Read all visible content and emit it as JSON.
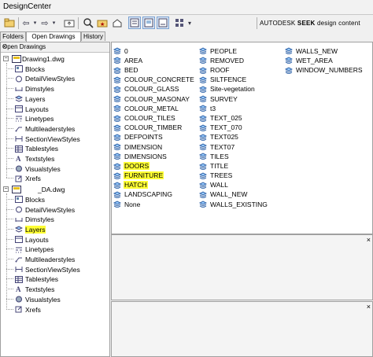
{
  "window": {
    "title": "DesignCenter"
  },
  "toolbar": {
    "dropdown_icon": "down-arrow",
    "brand_prefix": "AUTODESK",
    "brand_seek": "SEEK",
    "brand_suffix": "design content"
  },
  "tabs": [
    {
      "label": "Folders"
    },
    {
      "label": "Open Drawings"
    },
    {
      "label": "History"
    }
  ],
  "left_panel": {
    "header": "Open Drawings",
    "close": "×",
    "drawings": [
      {
        "name": "Drawing1.dwg",
        "items": [
          "Blocks",
          "DetailViewStyles",
          "Dimstyles",
          "Layers",
          "Layouts",
          "Linetypes",
          "Multileaderstyles",
          "SectionViewStyles",
          "Tablestyles",
          "Textstyles",
          "Visualstyles",
          "Xrefs"
        ]
      },
      {
        "name": "_DA.dwg",
        "items": [
          "Blocks",
          "DetailViewStyles",
          "Dimstyles",
          "Layers",
          "Layouts",
          "Linetypes",
          "Multileaderstyles",
          "SectionViewStyles",
          "Tablestyles",
          "Textstyles",
          "Visualstyles",
          "Xrefs"
        ]
      }
    ]
  },
  "layers": {
    "column1": [
      "0",
      "AREA",
      "BED",
      "COLOUR_CONCRETE",
      "COLOUR_GLASS",
      "COLOUR_MASONAY",
      "COLOUR_METAL",
      "COLOUR_TILES",
      "COLOUR_TIMBER",
      "DEFPOINTS",
      "DIMENSION",
      "DIMENSIONS",
      "DOORS",
      "FURNITURE",
      "HATCH",
      "LANDSCAPING",
      "None"
    ],
    "column2": [
      "PEOPLE",
      "REMOVED",
      "ROOF",
      "SILTFENCE",
      "Site-vegetation",
      "SURVEY",
      "t3",
      "TEXT_025",
      "TEXT_070",
      "TEXT025",
      "TEXT07",
      "TILES",
      "TITLE",
      "TREES",
      "WALL",
      "WALL_NEW",
      "WALLS_EXISTING"
    ],
    "column3": [
      "WALLS_NEW",
      "WET_AREA",
      "WINDOW_NUMBERS"
    ],
    "highlighted": [
      "DOORS",
      "FURNITURE",
      "HATCH"
    ]
  },
  "preview_pane": {
    "close": "×"
  },
  "description_pane": {
    "close": "×"
  },
  "colors": {
    "highlight": "#ffff33",
    "selected_tool": "#dce8f7"
  }
}
